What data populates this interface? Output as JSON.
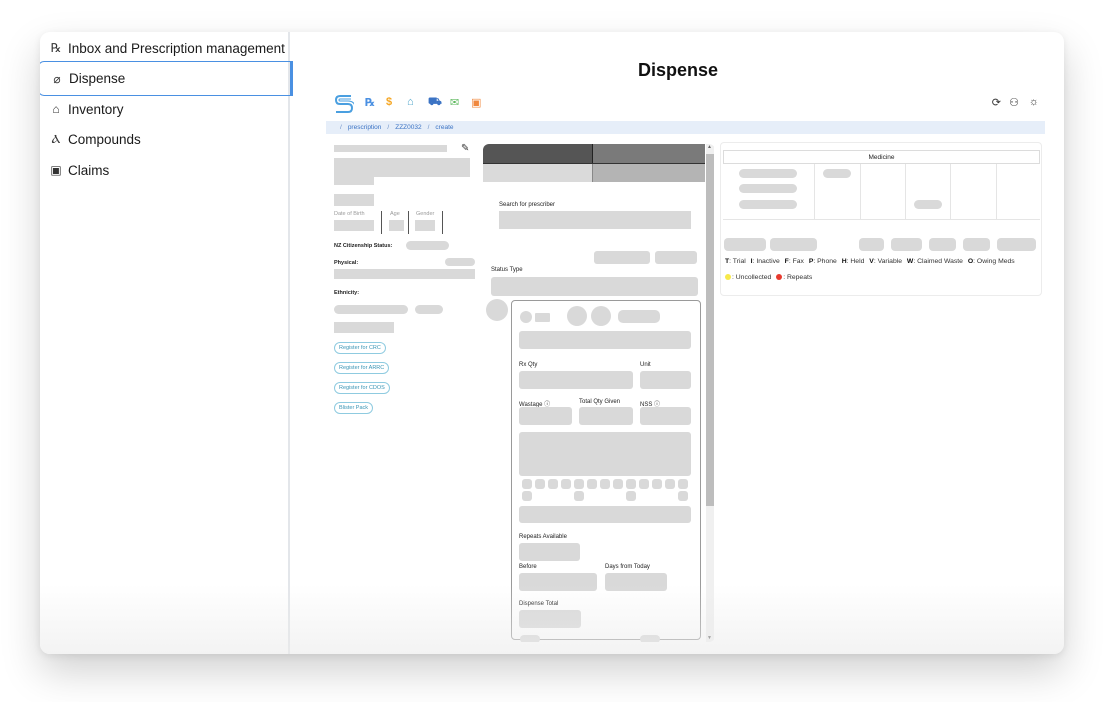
{
  "sidebar": {
    "items": [
      {
        "icon": "rx-icon",
        "glyph": "℞",
        "label": "Inbox and Prescription management",
        "active": false
      },
      {
        "icon": "pill-icon",
        "glyph": "⌀",
        "label": "Dispense",
        "active": true
      },
      {
        "icon": "warehouse-icon",
        "glyph": "⌂",
        "label": "Inventory",
        "active": false
      },
      {
        "icon": "flask-icon",
        "glyph": "Ⲁ",
        "label": "Compounds",
        "active": false
      },
      {
        "icon": "clipboard-dollar-icon",
        "glyph": "▣",
        "label": "Claims",
        "active": false
      }
    ]
  },
  "main": {
    "title": "Dispense",
    "toolbar": {
      "left_icons": [
        {
          "name": "rx-icon",
          "glyph": "℞",
          "color": "#4a90e2"
        },
        {
          "name": "dollar-icon",
          "glyph": "$",
          "color": "#f5a623"
        },
        {
          "name": "store-icon",
          "glyph": "⌂",
          "color": "#4aa3c9"
        },
        {
          "name": "cart-icon",
          "glyph": "⛟",
          "color": "#3b73c4"
        },
        {
          "name": "mail-icon",
          "glyph": "✉",
          "color": "#5cb85c"
        },
        {
          "name": "ledger-icon",
          "glyph": "▣",
          "color": "#f0883e"
        }
      ],
      "right_icons": [
        {
          "name": "refresh-icon",
          "glyph": "⟳"
        },
        {
          "name": "user-icon",
          "glyph": "⚇"
        },
        {
          "name": "brightness-icon",
          "glyph": "☼"
        }
      ]
    },
    "breadcrumb": [
      "prescription",
      "ZZZ0032",
      "create"
    ],
    "patient": {
      "dob_label": "Date of Birth",
      "age_label": "Age",
      "gender_label": "Gender",
      "citizenship_label": "NZ Citizenship Status:",
      "physical_label": "Physical:",
      "ethnicity_label": "Ethnicity:",
      "chips": [
        "Register for CRC",
        "Register for ARRC",
        "Register for CDOS",
        "Blister Pack"
      ]
    },
    "form": {
      "prescriber_label": "Search for prescriber",
      "status_type_label": "Status Type",
      "rx_qty_label": "Rx Qty",
      "unit_label": "Unit",
      "wastage_label": "Wastage ⓘ",
      "total_qty_label": "Total Qty Given",
      "nss_label": "NSS ⓘ",
      "repeats_label": "Repeats Available",
      "before_label": "Before",
      "days_label": "Days from Today",
      "dispense_total_label": "Dispense Total"
    },
    "medicine_panel": {
      "header": "Medicine",
      "legend_line1": [
        {
          "key": "T",
          "text": "Trial"
        },
        {
          "key": "I",
          "text": "Inactive"
        },
        {
          "key": "F",
          "text": "Fax"
        },
        {
          "key": "P",
          "text": "Phone"
        },
        {
          "key": "H",
          "text": "Held"
        },
        {
          "key": "V",
          "text": "Variable"
        },
        {
          "key": "W",
          "text": "Claimed Waste"
        },
        {
          "key": "O",
          "text": "Owing Meds"
        }
      ],
      "legend_line2": [
        {
          "color": "#f7e94a",
          "text": "Uncollected"
        },
        {
          "color": "#e83a2e",
          "text": "Repeats"
        }
      ]
    }
  }
}
